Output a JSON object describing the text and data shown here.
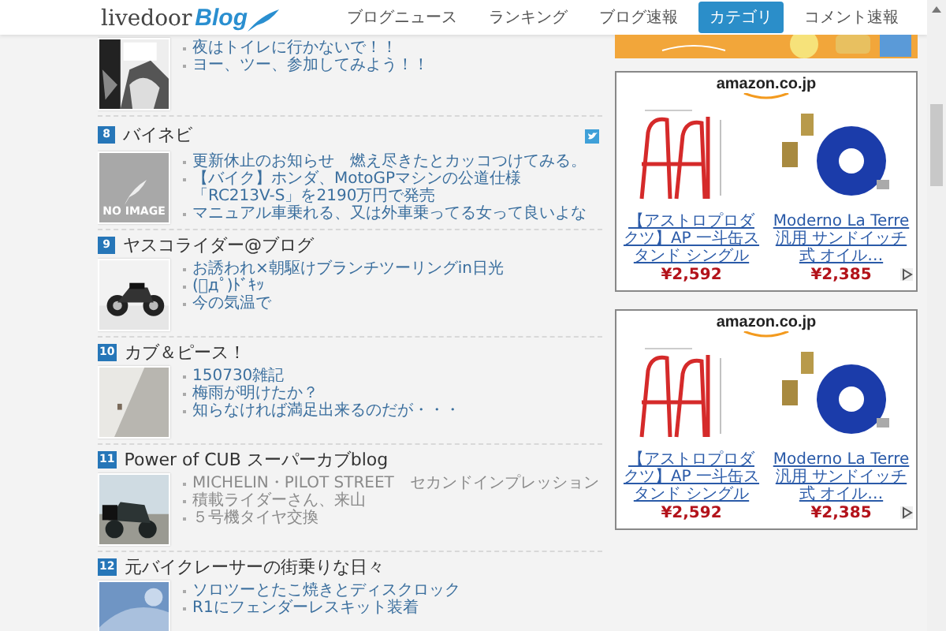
{
  "header": {
    "logo": {
      "text": "livedoor",
      "blog": "Blog"
    },
    "nav": [
      {
        "label": "ブログニュース",
        "selected": false
      },
      {
        "label": "ランキング",
        "selected": false
      },
      {
        "label": "ブログ速報",
        "selected": false
      },
      {
        "label": "カテゴリ",
        "selected": true
      },
      {
        "label": "コメント速報",
        "selected": false
      }
    ]
  },
  "entries": [
    {
      "thumbnail": {
        "kind": "picture"
      },
      "visited": false,
      "links": [
        "夜はトイレに行かないで！！",
        "ヨー、ツー、参加してみよう！！"
      ]
    },
    {
      "number": "8",
      "title": "バイネビ",
      "tweet_button": true,
      "visited": false,
      "thumbnail": {
        "kind": "placeholder",
        "label": "NO IMAGE"
      },
      "links": [
        "更新休止のお知らせ　燃え尽きたとカッコつけてみる。",
        "【バイク】ホンダ、MotoGPマシンの公道仕様「RC213V-S」を2190万円で発売",
        "マニュアル車乗れる、又は外車乗ってる女って良いよな"
      ]
    },
    {
      "number": "9",
      "title": "ヤスコライダー@ブログ",
      "visited": false,
      "thumbnail": {
        "kind": "picture"
      },
      "links": [
        "お誘われ×朝駆けブランチツーリングin日光",
        "(ﾟдﾟ)ﾄﾞｷｯ",
        "今の気温で"
      ]
    },
    {
      "number": "10",
      "title": "カブ＆ピース！",
      "visited": false,
      "thumbnail": {
        "kind": "picture"
      },
      "links": [
        "150730雑記",
        "梅雨が明けたか？",
        "知らなければ満足出来るのだが・・・"
      ]
    },
    {
      "number": "11",
      "title": "Power of CUB スーパーカブblog",
      "visited": true,
      "thumbnail": {
        "kind": "picture"
      },
      "links": [
        "MICHELIN・PILOT STREET　セカンドインプレッション",
        "積載ライダーさん、来山",
        "５号機タイヤ交換"
      ]
    },
    {
      "number": "12",
      "title": "元バイクレーサーの街乗りな日々",
      "visited": false,
      "thumbnail": {
        "kind": "picture"
      },
      "links": [
        "ソロツーとたこ焼きとディスクロック",
        "R1にフェンダーレスキット装着"
      ]
    }
  ],
  "sidebar": {
    "banner": {
      "kind": "picture"
    },
    "ads": [
      {
        "logo": "amazon.co.jp",
        "products": [
          {
            "name": "【アストロプロダクツ】AP 一斗缶スタンド シングル",
            "price": "¥2,592"
          },
          {
            "name": "Moderno La Terre 汎用 サンドイッチ式 オイル…",
            "price": "¥2,385"
          }
        ]
      },
      {
        "logo": "amazon.co.jp",
        "products": [
          {
            "name": "【アストロプロダクツ】AP 一斗缶スタンド シングル",
            "price": "¥2,592"
          },
          {
            "name": "Moderno La Terre 汎用 サンドイッチ式 オイル…",
            "price": "¥2,385"
          }
        ]
      }
    ]
  }
}
